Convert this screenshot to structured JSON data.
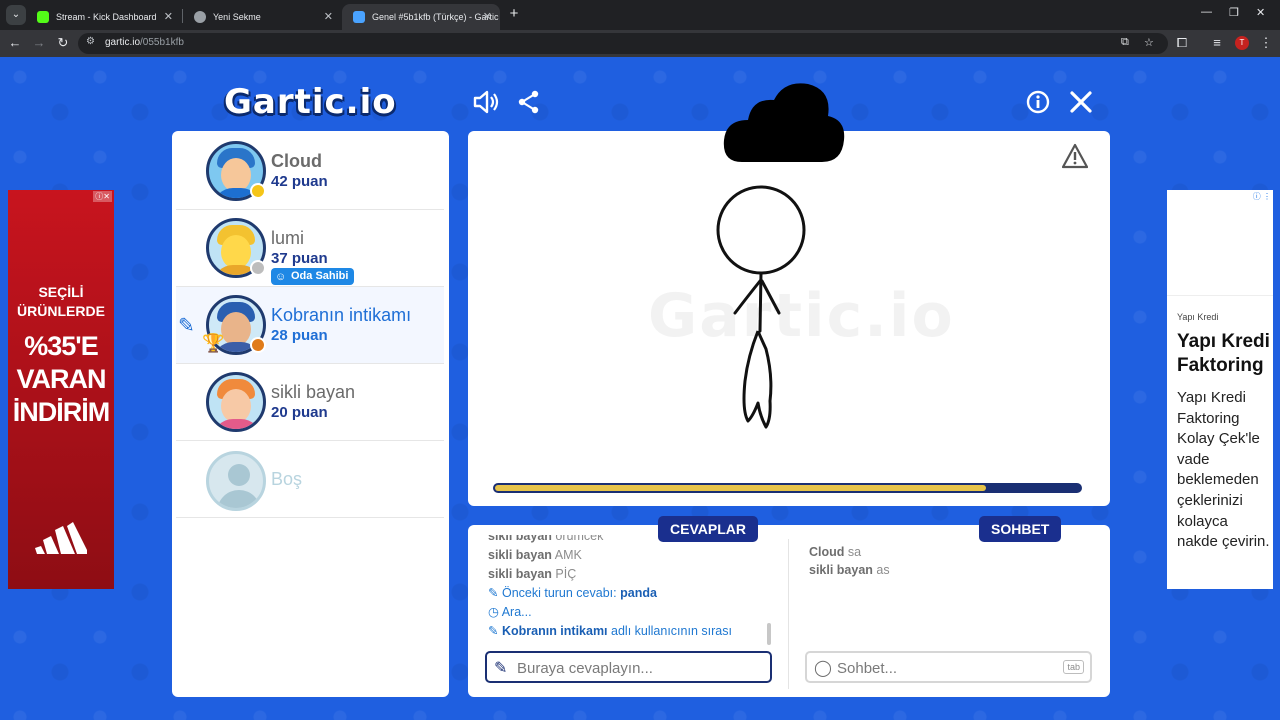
{
  "browser": {
    "tabs": [
      {
        "title": "Stream - Kick Dashboard",
        "favicon_color": "#53fc18"
      },
      {
        "title": "Yeni Sekme",
        "favicon_color": "#9aa0a6"
      },
      {
        "title": "Genel #5b1kfb (Türkçe) - Gartic",
        "favicon_color": "#4aa3ff"
      }
    ],
    "url_host": "gartic.io",
    "url_path": "/055b1kfb",
    "profile_initial": "T"
  },
  "game": {
    "logo": "Gartic.io",
    "players": [
      {
        "name": "Cloud",
        "score": "42 puan",
        "status_color": "#f5c518"
      },
      {
        "name": "lumi",
        "score": "37 puan",
        "badge": "Oda Sahibi",
        "status_color": "#bdbdbd"
      },
      {
        "name": "Kobranın intikamı",
        "score": "28 puan",
        "status_color": "#e07b1a"
      },
      {
        "name": "sikli bayan",
        "score": "20 puan"
      },
      {
        "name": "Boş"
      }
    ],
    "timer_progress": 0.84,
    "answers_tab": "CEVAPLAR",
    "chat_tab": "SOHBET",
    "answers": {
      "partial": {
        "user": "sikli bayan",
        "text": "örümcek"
      },
      "lines": [
        {
          "user": "sikli bayan",
          "text": "AMK"
        },
        {
          "user": "sikli bayan",
          "text": "PİÇ"
        }
      ],
      "previous_answer_label": "Önceki turun cevabı:",
      "previous_answer": "panda",
      "interval_text": "Ara...",
      "turn_user": "Kobranın intikamı",
      "turn_text": "adlı kullanıcının sırası",
      "placeholder": "Buraya cevaplayın..."
    },
    "chat": {
      "lines": [
        {
          "user": "Cloud",
          "text": "sa"
        },
        {
          "user": "sikli bayan",
          "text": "as"
        }
      ],
      "placeholder": "Sohbet...",
      "tab_key": "tab"
    }
  },
  "ads": {
    "left": {
      "line1": "SEÇİLİ",
      "line2": "ÜRÜNLERDE",
      "line3": "%35'E",
      "line4": "VARAN",
      "line5": "İNDİRİM",
      "brand_icon": "adidas-logo"
    },
    "right": {
      "brand": "Yapı Kredi",
      "title": "Yapı Kredi Faktoring",
      "body": "Yapı Kredi Faktoring Kolay Çek'le vade beklemeden çeklerinizi kolayca nakde çevirin."
    }
  }
}
